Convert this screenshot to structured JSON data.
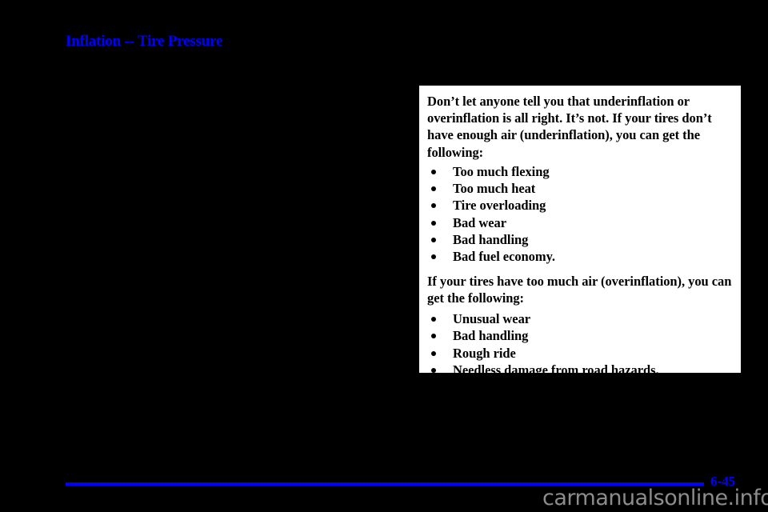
{
  "page": {
    "background_color": "#000000",
    "accent_color": "#0000ff",
    "heading": "Inflation -- Tire Pressure"
  },
  "callout": {
    "background_color": "#ffffff",
    "text_color": "#000000",
    "intro_paragraph": "Don’t let anyone tell you that underinflation or overinflation is all right. It’s not. If your tires don’t have enough air (underinflation), you can get the following:",
    "underinflation_items": [
      "Too much flexing",
      "Too much heat",
      "Tire overloading",
      "Bad wear",
      "Bad handling",
      "Bad fuel economy."
    ],
    "second_paragraph": "If your tires have too much air (overinflation), you can get the following:",
    "overinflation_items": [
      "Unusual wear",
      "Bad handling",
      "Rough ride",
      "Needless damage from road hazards."
    ]
  },
  "footer": {
    "page_number": "6-45",
    "watermark": "carmanualsonline.info",
    "rule_color": "#0000ff",
    "watermark_color": "#8c8c8c"
  }
}
